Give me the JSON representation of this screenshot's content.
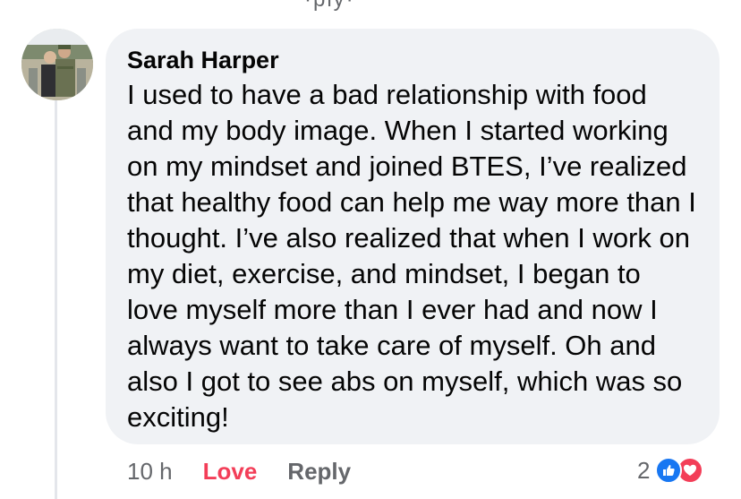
{
  "comment": {
    "author": "Sarah Harper",
    "text": "I used to have a bad relationship with food and my body image. When I started working on my mindset and joined BTES, I’ve realized that healthy food can help me way more than I thought. I’ve also realized that when I work on my diet, exercise, and mindset, I began to love myself more than I ever had and now I always want to take care of myself. Oh and also I got to see abs on myself, which was so exciting!",
    "timestamp": "10 h",
    "love_label": "Love",
    "reply_label": "Reply",
    "reaction_count": "2",
    "reactions": [
      "like-icon",
      "love-icon"
    ]
  },
  "colors": {
    "bubble": "#f0f2f5",
    "love": "#f33e58",
    "like": "#1877f2",
    "muted": "#65676b"
  }
}
